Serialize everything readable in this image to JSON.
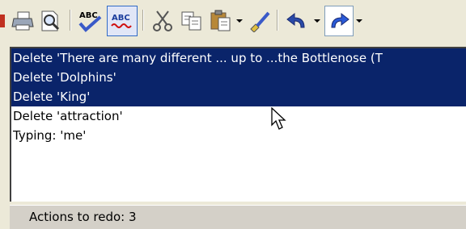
{
  "toolbar": {
    "buttons": [
      {
        "name": "print-icon"
      },
      {
        "name": "print-preview-icon"
      },
      {
        "name": "spelling-check-icon"
      },
      {
        "name": "auto-spell-check-icon",
        "pressed": true
      },
      {
        "name": "cut-icon"
      },
      {
        "name": "copy-icon"
      },
      {
        "name": "paste-icon"
      },
      {
        "name": "format-painter-icon"
      },
      {
        "name": "undo-icon"
      },
      {
        "name": "redo-icon"
      }
    ]
  },
  "redo_list": {
    "items": [
      {
        "text": "Delete 'There are many different ... up to ...the Bottlenose (T",
        "selected": true
      },
      {
        "text": "Delete 'Dolphins'",
        "selected": true
      },
      {
        "text": "Delete 'King'",
        "selected": true
      },
      {
        "text": "Delete 'attraction'",
        "selected": false
      },
      {
        "text": "Typing: 'me'",
        "selected": false
      }
    ]
  },
  "status": {
    "text": "Actions to redo: 3"
  },
  "colors": {
    "selection": "#0a246a",
    "toolbar_bg": "#ece9d8"
  }
}
